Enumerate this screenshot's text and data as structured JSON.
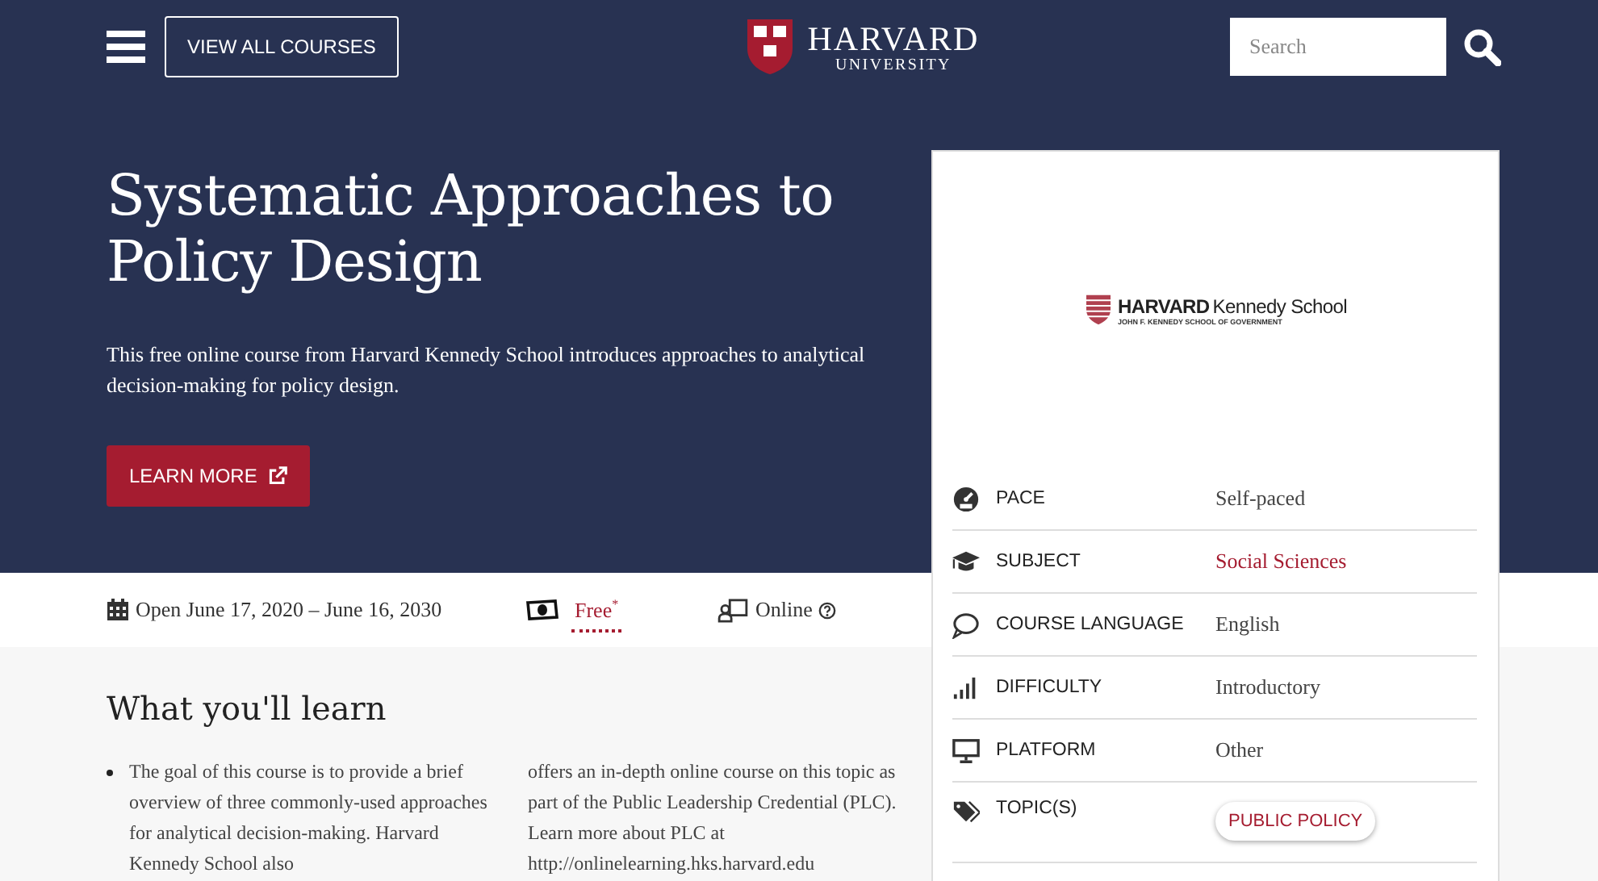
{
  "header": {
    "view_all_button": "VIEW ALL COURSES",
    "logo": {
      "name": "HARVARD",
      "sub": "UNIVERSITY"
    },
    "search": {
      "placeholder": "Search"
    }
  },
  "hero": {
    "title": "Systematic Approaches to Policy Design",
    "description": "This free online course from Harvard Kennedy School introduces approaches to analytical decision-making for policy design.",
    "button": "LEARN MORE"
  },
  "facts": [
    {
      "kind": "date",
      "text": "Open June 17, 2020 – June 16, 2030"
    },
    {
      "kind": "price",
      "text": "Free",
      "mark": "*"
    },
    {
      "kind": "mode",
      "text": "Online"
    }
  ],
  "learn": {
    "heading": "What you'll learn",
    "column_1": "The goal of this course is to provide a brief overview of three commonly-used approaches for analytical decision-making. Harvard Kennedy School also",
    "column_2": "offers an in-depth online course on this topic as part of the Public Leadership Credential (PLC). Learn more about PLC at http://onlinelearning.hks.harvard.edu"
  },
  "card": {
    "logo": {
      "name_bold": "HARVARD",
      "name": "Kennedy School",
      "sub": "JOHN F. KENNEDY SCHOOL OF GOVERNMENT"
    },
    "rows": [
      {
        "label": "PACE",
        "value": "Self-paced",
        "kind": "text"
      },
      {
        "label": "SUBJECT",
        "value": "Social Sciences",
        "kind": "link"
      },
      {
        "label": "COURSE LANGUAGE",
        "value": "English",
        "kind": "text"
      },
      {
        "label": "DIFFICULTY",
        "value": "Introductory",
        "kind": "text"
      },
      {
        "label": "PLATFORM",
        "value": "Other",
        "kind": "text"
      },
      {
        "label": "TOPIC(S)",
        "value": "PUBLIC POLICY",
        "kind": "tag"
      }
    ]
  }
}
